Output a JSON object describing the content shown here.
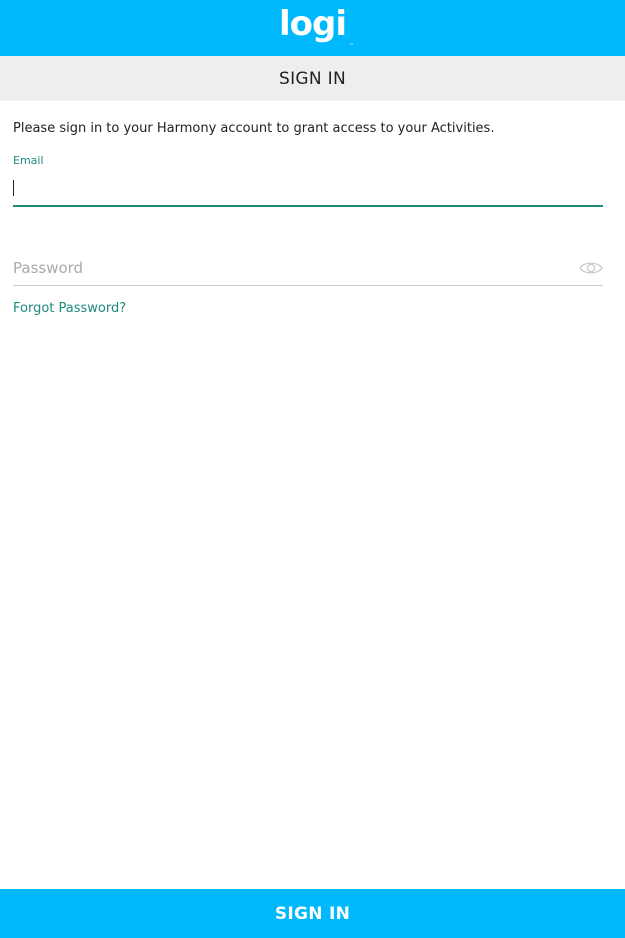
{
  "header": {
    "logo_text": "logi",
    "logo_mark": "™",
    "background_color": "#00b8fc"
  },
  "title_bar": {
    "title": "SIGN IN"
  },
  "form": {
    "intro": "Please sign in to your Harmony account to grant access to your Activities.",
    "email": {
      "label": "Email",
      "value": "",
      "accent_color": "#1f8a7e"
    },
    "password": {
      "placeholder": "Password",
      "value": "",
      "toggle_icon": "eye-icon"
    },
    "forgot_password": "Forgot Password?"
  },
  "footer": {
    "sign_in_label": "SIGN IN"
  }
}
